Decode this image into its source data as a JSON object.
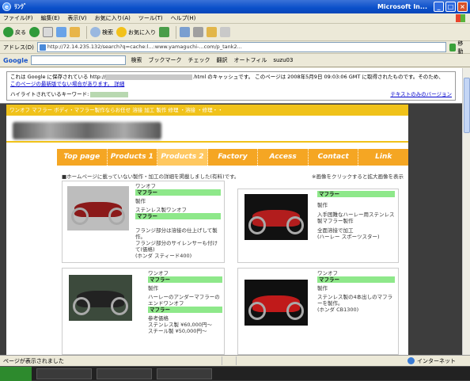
{
  "window": {
    "title": "ﾘﾝｸﾞ",
    "app_name": "Microsoft In..."
  },
  "menubar": {
    "items": [
      "ファイル(F)",
      "編集(E)",
      "表示(V)",
      "お気に入り(A)",
      "ツール(T)",
      "ヘルプ(H)"
    ]
  },
  "toolbar": {
    "back_label": "戻る",
    "search_label": "検索",
    "favorites_label": "お気に入り"
  },
  "address": {
    "label": "アドレス(D)",
    "url": "http://72.14.235.132/search?q=cache:l...:www.yamaguchi-...com/p_tank2...",
    "go_label": "移動"
  },
  "google_bar": {
    "logo": "Google",
    "search_label": "検索",
    "bookmarks_label": "ブックマーク",
    "check_label": "チェック",
    "translate_label": "翻訳",
    "autofill_label": "オートフィル",
    "user_label": "suzu03"
  },
  "cache_notice": {
    "line1_a": "これは Google に保存されている http://",
    "line1_b": ".html のキャッシュです。 このページは 2008年5月9日 09:03:06 GMT に取得されたものです。そのため、",
    "line2": "このページの最新版でない場合があります。 詳細",
    "keyword_label": "ハイライトされているキーワード:",
    "text_version": "テキストのみのバージョン"
  },
  "site": {
    "top_bar_text": "ワンオフ マフラー ボディ・マフラー製作ならお任せ 溶接 加工 製作 修理 ・溶接 ・修理・・",
    "nav": [
      "Top page",
      "Products 1",
      "Products 2",
      "Factory",
      "Access",
      "Contact",
      "Link"
    ],
    "nav_active": "Products 2",
    "note_left": "■ホームページに載っていない製作・加工の詳細を掲載しました(有料)です。",
    "note_right": "※画像をクリックすると拡大画像を表示"
  },
  "cards": [
    {
      "label_oneoff": "ワンオフ",
      "label_muffler": "マフラー",
      "label_make": "製作",
      "body1": "ステンレス製ワンオフ",
      "label_muffler2": "マフラー",
      "body2": "フランジ部分は溶接の仕上げして製作。",
      "body3": "フランジ部分のサイレンサーも付けて(価格)",
      "price": "(ホンダ スティード400)"
    },
    {
      "label_muffler": "マフラー",
      "label_make": "製作",
      "body1": "入手困難なハーレー用ステンレス製マフラー製作",
      "body2": "全面溶接で加工",
      "price": "(ハーレー スポーツスター)"
    },
    {
      "label_oneoff": "ワンオフ",
      "label_muffler": "マフラー",
      "label_make": "製作",
      "body1": "ハーレーのアンダーマフラーのエンドワンオフ",
      "label_muffler2": "マフラー",
      "body2": "参考価格",
      "body3": "ステンレス製 ¥60,000円～",
      "price": "スチール製 ¥50,000円～"
    },
    {
      "label_oneoff": "ワンオフ",
      "label_muffler": "マフラー",
      "label_make": "製作",
      "body1": "ステンレス製の4本出しのマフラーを製作。",
      "price": "(ホンダ CB1300)"
    }
  ],
  "status": {
    "text": "ページが表示されました",
    "zone": "インターネット"
  }
}
